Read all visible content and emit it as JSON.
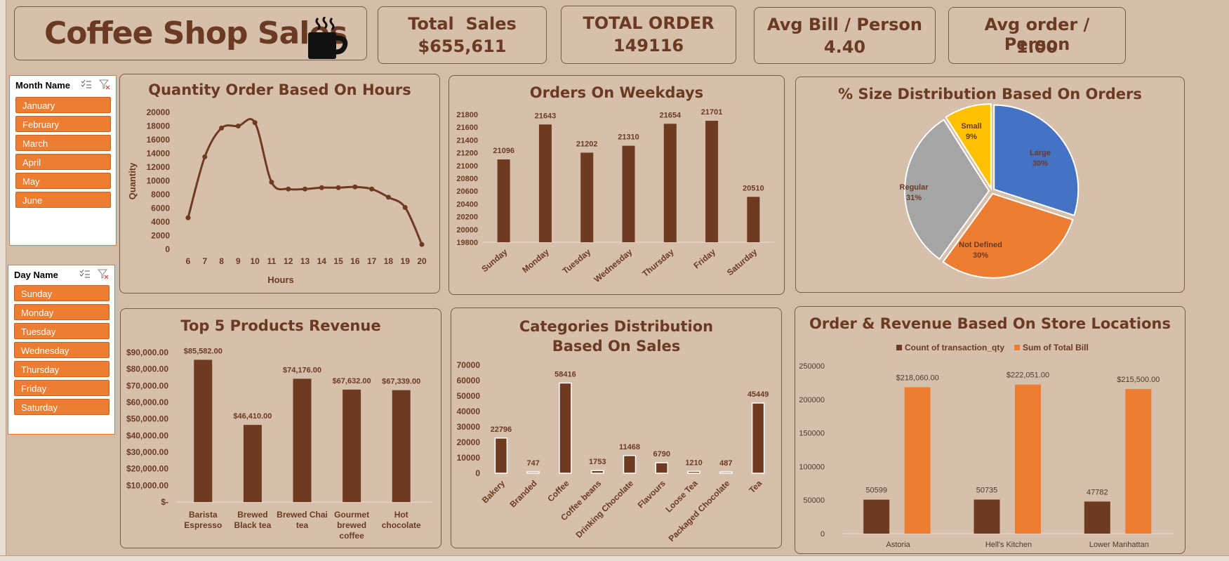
{
  "header": {
    "title": "Coffee Shop Sales",
    "icon": "coffee-cup-icon"
  },
  "kpis": [
    {
      "label": "Total  Sales",
      "value": "$655,611"
    },
    {
      "label": "TOTAL ORDER",
      "value": "149116"
    },
    {
      "label": "Avg Bill / Person",
      "value": "4.40"
    },
    {
      "label": "Avg order / Person",
      "value": "1.00"
    }
  ],
  "slicers": {
    "month": {
      "header": "Month Name",
      "items": [
        "January",
        "February",
        "March",
        "April",
        "May",
        "June"
      ]
    },
    "day": {
      "header": "Day Name",
      "items": [
        "Sunday",
        "Monday",
        "Tuesday",
        "Wednesday",
        "Thursday",
        "Friday",
        "Saturday"
      ]
    }
  },
  "colors": {
    "brown": "#6e3b20",
    "orange": "#ed7d31",
    "blue": "#4472c4",
    "gray": "#a5a5a5",
    "gold": "#ffc000",
    "background": "#d3bca8"
  },
  "chart_data": [
    {
      "id": "hours",
      "type": "line",
      "title": "Quantity Order Based On Hours",
      "xlabel": "Hours",
      "ylabel": "Quantity",
      "x": [
        6,
        7,
        8,
        9,
        10,
        11,
        12,
        13,
        14,
        15,
        16,
        17,
        18,
        19,
        20
      ],
      "values": [
        4600,
        13500,
        17700,
        18000,
        18500,
        9800,
        8800,
        8800,
        9000,
        9000,
        9100,
        8800,
        7600,
        6100,
        700
      ],
      "ylim": [
        0,
        20000
      ],
      "yticks": [
        "0",
        "2000",
        "4000",
        "6000",
        "8000",
        "10000",
        "12000",
        "14000",
        "16000",
        "18000",
        "20000"
      ]
    },
    {
      "id": "weekdays",
      "type": "bar",
      "title": "Orders On Weekdays",
      "categories": [
        "Sunday",
        "Monday",
        "Tuesday",
        "Wednesday",
        "Thursday",
        "Friday",
        "Saturday"
      ],
      "values": [
        21096,
        21643,
        21202,
        21310,
        21654,
        21701,
        20510
      ],
      "data_labels": [
        "21096",
        "21643",
        "21202",
        "21310",
        "21654",
        "21701",
        "20510"
      ],
      "ylim": [
        19800,
        21800
      ],
      "yticks": [
        "19800",
        "20000",
        "20200",
        "20400",
        "20600",
        "20800",
        "21000",
        "21200",
        "21400",
        "21600",
        "21800"
      ]
    },
    {
      "id": "size",
      "type": "pie",
      "title": "% Size  Distribution Based On Orders",
      "slices": [
        {
          "label": "Large",
          "pct": "30%",
          "value": 30,
          "color": "#4472c4"
        },
        {
          "label": "Not Defined",
          "pct": "30%",
          "value": 30,
          "color": "#ed7d31"
        },
        {
          "label": "Regular",
          "pct": "31%",
          "value": 31,
          "color": "#a5a5a5"
        },
        {
          "label": "Small",
          "pct": "9%",
          "value": 9,
          "color": "#ffc000"
        }
      ]
    },
    {
      "id": "products",
      "type": "bar",
      "title": "Top 5 Products Revenue",
      "categories": [
        [
          "Barista",
          "Espresso"
        ],
        [
          "Brewed",
          "Black tea"
        ],
        [
          "Brewed Chai",
          "tea"
        ],
        [
          "Gourmet",
          "brewed",
          "coffee"
        ],
        [
          "Hot",
          "chocolate"
        ]
      ],
      "values": [
        85582,
        46410,
        74176,
        67632,
        67339
      ],
      "data_labels": [
        "$85,582.00",
        "$46,410.00",
        "$74,176.00",
        "$67,632.00",
        "$67,339.00"
      ],
      "ylim": [
        0,
        90000
      ],
      "yticks": [
        "$-",
        "$10,000.00",
        "$20,000.00",
        "$30,000.00",
        "$40,000.00",
        "$50,000.00",
        "$60,000.00",
        "$70,000.00",
        "$80,000.00",
        "$90,000.00"
      ]
    },
    {
      "id": "categories",
      "type": "bar",
      "title": "Categories Distribution Based On Sales",
      "categories": [
        "Bakery",
        "Branded",
        "Coffee",
        "Coffee beans",
        "Drinking Chocolate",
        "Flavours",
        "Loose Tea",
        "Packaged Chocolate",
        "Tea"
      ],
      "values": [
        22796,
        747,
        58416,
        1753,
        11468,
        6790,
        1210,
        487,
        45449
      ],
      "data_labels": [
        "22796",
        "747",
        "58416",
        "1753",
        "11468",
        "6790",
        "1210",
        "487",
        "45449"
      ],
      "ylim": [
        0,
        70000
      ],
      "yticks": [
        "0",
        "10000",
        "20000",
        "30000",
        "40000",
        "50000",
        "60000",
        "70000"
      ]
    },
    {
      "id": "stores",
      "type": "bar",
      "title": "Order & Revenue Based On Store Locations",
      "categories": [
        "Astoria",
        "Hell's Kitchen",
        "Lower Manhattan"
      ],
      "series": [
        {
          "name": "Count of transaction_qty",
          "values": [
            50599,
            50735,
            47782
          ],
          "labels": [
            "50599",
            "50735",
            "47782"
          ],
          "color": "#6e3b20"
        },
        {
          "name": "Sum of Total Bill",
          "values": [
            218060,
            222051,
            215500
          ],
          "labels": [
            "$218,060.00",
            "$222,051.00",
            "$215,500.00"
          ],
          "color": "#ed7d31"
        }
      ],
      "ylim": [
        0,
        250000
      ],
      "yticks": [
        "0",
        "50000",
        "100000",
        "150000",
        "200000",
        "250000"
      ],
      "legend": "top"
    }
  ]
}
